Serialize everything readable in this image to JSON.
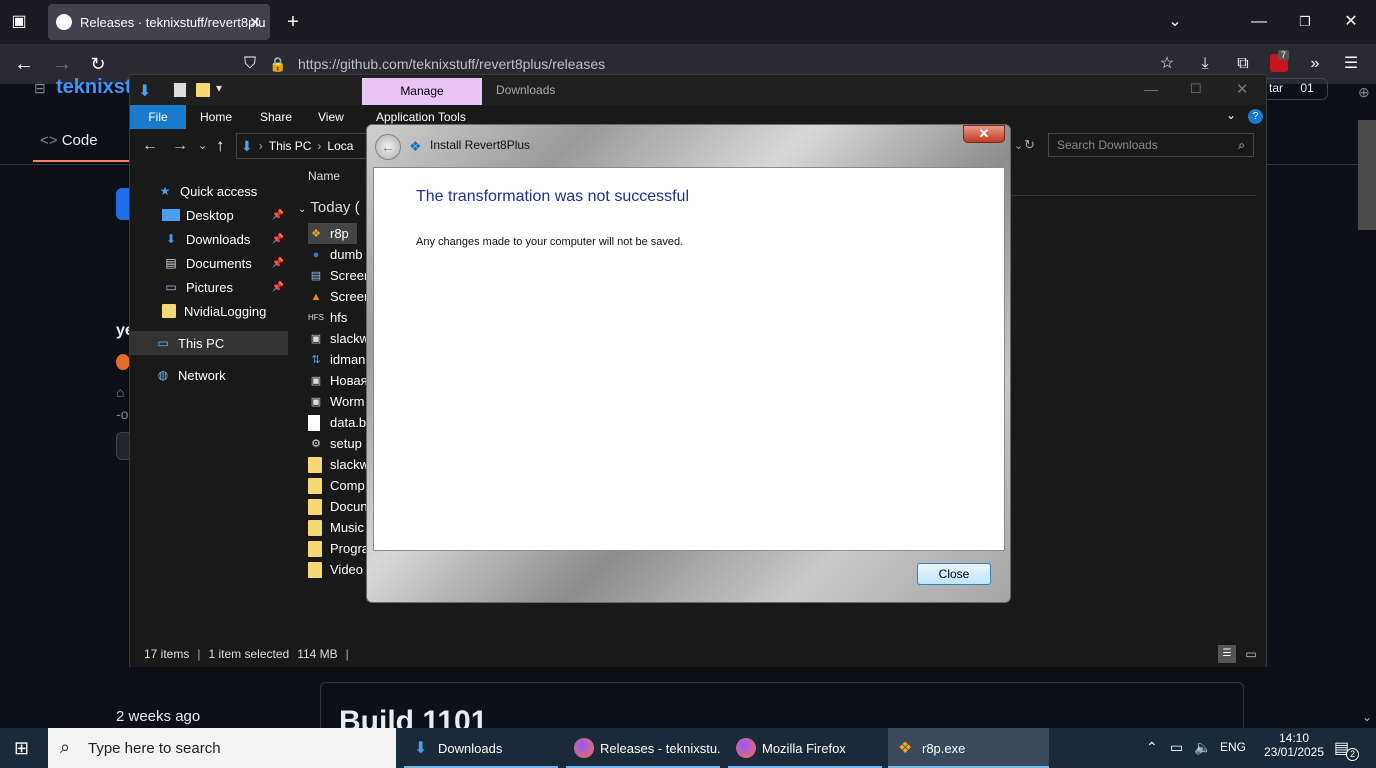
{
  "browser": {
    "tab_title": "Releases · teknixstuff/revert8plu",
    "url": "https://github.com/teknixstuff/revert8plus/releases",
    "extension_badge": "7"
  },
  "github": {
    "repo_owner": "teknixstu",
    "code_tab": "Code",
    "star_label": "tar",
    "star_count": "01",
    "partial_text": "ye",
    "release_age": "2 weeks ago",
    "release_title": "Build 1101"
  },
  "explorer": {
    "ribbon_tab_manage": "Manage",
    "window_title": "Downloads",
    "ribbon": {
      "file": "File",
      "home": "Home",
      "share": "Share",
      "view": "View",
      "app_tools": "Application Tools"
    },
    "breadcrumb": {
      "this_pc": "This PC",
      "local": "Loca"
    },
    "search_placeholder": "Search Downloads",
    "column_name": "Name",
    "group_today": "Today (",
    "nav": {
      "quick_access": "Quick access",
      "desktop": "Desktop",
      "downloads": "Downloads",
      "documents": "Documents",
      "pictures": "Pictures",
      "nvidia": "NvidiaLogging",
      "this_pc": "This PC",
      "network": "Network"
    },
    "files": [
      "r8p",
      "dumb",
      "Screen",
      "Screen",
      "hfs",
      "slackw",
      "idman",
      "Новая",
      "Worm",
      "data.b",
      "setup",
      "slackw",
      "Comp",
      "Docun",
      "Music",
      "Progra",
      "Video"
    ],
    "status": {
      "items": "17 items",
      "selected": "1 item selected",
      "size": "114 MB"
    }
  },
  "dialog": {
    "title": "Install Revert8Plus",
    "heading": "The transformation was not successful",
    "message": "Any changes made to your computer will not be saved.",
    "close_button": "Close"
  },
  "taskbar": {
    "search_placeholder": "Type here to search",
    "items": [
      "Downloads",
      "Releases - teknixstu...",
      "Mozilla Firefox",
      "r8p.exe"
    ],
    "language": "ENG",
    "time": "14:10",
    "date": "23/01/2025",
    "notification_count": "2"
  }
}
